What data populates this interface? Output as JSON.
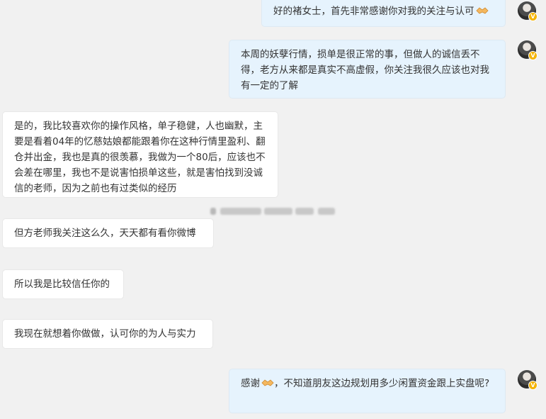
{
  "messages": [
    {
      "direction": "out",
      "text": "好的褚女士，首先非常感谢你对我的关注与认可",
      "emoji_after": "handshake-emoji"
    },
    {
      "direction": "out",
      "text": "本周的妖孽行情，损单是很正常的事，但做人的诚信丢不得，老方从来都是真实不高虚假，你关注我很久应该也对我有一定的了解"
    },
    {
      "direction": "in",
      "text": "是的，我比较喜欢你的操作风格，单子稳健，人也幽默，主要是看着04年的忆慈姑娘都能跟着你在这种行情里盈利、翻仓并出金，我也是真的很羡慕，我做为一个80后，应该也不会差在哪里，我也不是说害怕损单这些，就是害怕找到没诚信的老师，因为之前也有过类似的经历"
    },
    {
      "direction": "in",
      "text": "但方老师我关注这么久，天天都有看你微博"
    },
    {
      "direction": "in",
      "text": "所以我是比较信任你的"
    },
    {
      "direction": "in",
      "text": "我现在就想着你做做，认可你的为人与实力"
    },
    {
      "direction": "out",
      "text_before": "感谢",
      "emoji": "handshake-emoji",
      "text_after": "，不知道朋友这边规划用多少闲置资金跟上实盘呢?"
    }
  ],
  "avatar_badge": "V",
  "colors": {
    "background": "#f1f1f1",
    "outgoing_bubble": "#e6f3fd",
    "incoming_bubble": "#ffffff",
    "text": "#333333",
    "verified_badge": "#f5b400"
  }
}
